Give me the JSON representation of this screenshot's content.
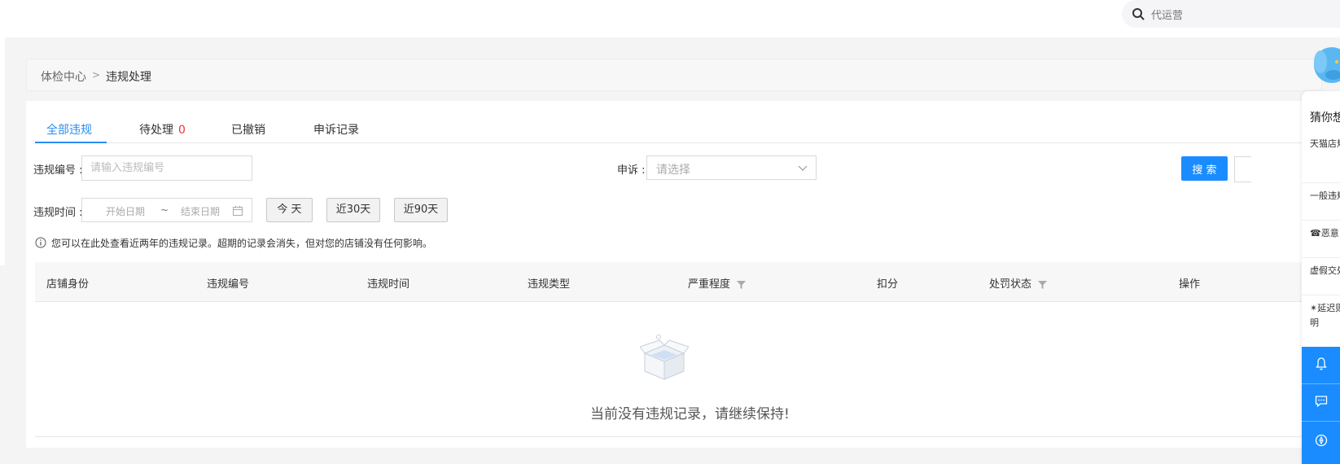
{
  "header": {
    "search_placeholder": "代运营"
  },
  "breadcrumb": {
    "items": [
      "体检中心",
      "违规处理"
    ],
    "separator": ">"
  },
  "tabs": [
    {
      "label": "全部违规",
      "active": true
    },
    {
      "label": "待处理",
      "count": "0"
    },
    {
      "label": "已撤销"
    },
    {
      "label": "申诉记录"
    }
  ],
  "filters": {
    "violation_no_label": "违规编号 :",
    "violation_no_placeholder": "请输入违规编号",
    "appeal_label": "申诉 :",
    "appeal_placeholder": "请选择",
    "time_label": "违规时间 :",
    "start_placeholder": "开始日期",
    "range_sep": "~",
    "end_placeholder": "结束日期",
    "quick_today": "今 天",
    "quick_30": "近30天",
    "quick_90": "近90天",
    "search_button": "搜 索"
  },
  "notice": "您可以在此处查看近两年的违规记录。超期的记录会消失，但对您的店铺没有任何影响。",
  "table": {
    "columns": [
      "店铺身份",
      "违规编号",
      "违规时间",
      "违规类型",
      "严重程度",
      "扣分",
      "处罚状态",
      "操作"
    ],
    "empty_text": "当前没有违规记录，请继续保持!"
  },
  "side_panel": {
    "title": "猜你想",
    "questions": [
      "天猫店规节点罚？",
      "一般违规的区",
      "☎恶意口在哪",
      "虚假交处罚的",
      "✴延迟则（含货说明"
    ]
  },
  "colors": {
    "accent": "#1a8cff",
    "active_tab": "#2a8df2",
    "count_red": "#ee3333"
  }
}
